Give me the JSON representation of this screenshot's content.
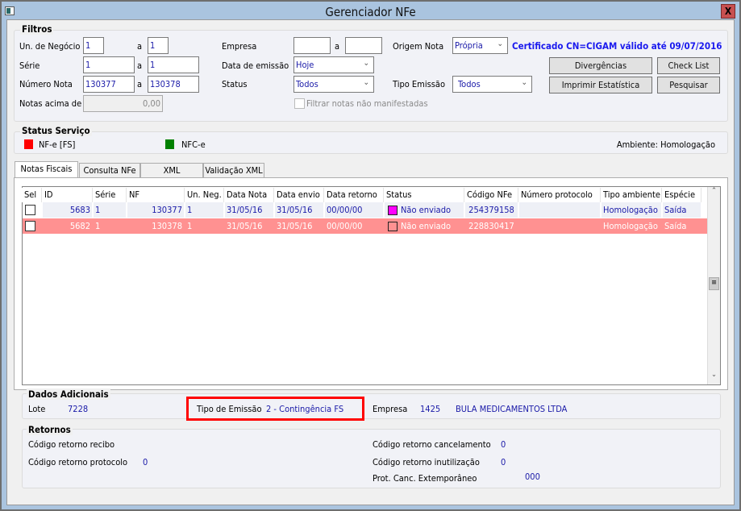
{
  "window": {
    "title": "Gerenciador NFe",
    "close_label": "X"
  },
  "filtros": {
    "title": "Filtros",
    "un_negocio": {
      "label": "Un. de Negócio",
      "from": "1",
      "to": "1"
    },
    "serie": {
      "label": "Série",
      "from": "1",
      "to": "1"
    },
    "numero_nota": {
      "label": "Número Nota",
      "from": "130377",
      "to": "130378"
    },
    "notas_acima": {
      "label": "Notas acima de",
      "value": "0,00"
    },
    "range_sep": "a",
    "empresa": {
      "label": "Empresa",
      "from": "",
      "to": ""
    },
    "data_emissao": {
      "label": "Data de emissão",
      "value": "Hoje"
    },
    "status": {
      "label": "Status",
      "value": "Todos"
    },
    "filtrar_manifestadas": {
      "label": "Filtrar notas não manifestadas",
      "checked": false
    },
    "origem_nota": {
      "label": "Origem Nota",
      "value": "Própria"
    },
    "tipo_emissao": {
      "label": "Tipo Emissão",
      "value": "Todos"
    },
    "certificado": "Certificado CN=CIGAM válido até 09/07/2016",
    "buttons": {
      "divergencias": "Divergências",
      "check_list": "Check List",
      "imprimir": "Imprimir Estatística",
      "pesquisar": "Pesquisar"
    }
  },
  "status_servico": {
    "title": "Status Serviço",
    "nfe": {
      "label": "NF-e  [FS]",
      "color": "#ff0000"
    },
    "nfce": {
      "label": "NFC-e",
      "color": "#008000"
    },
    "ambiente": "Ambiente: Homologação"
  },
  "tabs": [
    {
      "label": "Notas Fiscais",
      "active": true
    },
    {
      "label": "Consulta NFe"
    },
    {
      "label": "XML"
    },
    {
      "label": "Validação XML"
    }
  ],
  "grid": {
    "columns": [
      "Sel",
      "ID",
      "Série",
      "NF",
      "Un. Neg.",
      "Data Nota",
      "Data envio",
      "Data retorno",
      "Status",
      "Código NFe",
      "Número protocolo",
      "Tipo ambiente",
      "Espécie"
    ],
    "rows": [
      {
        "sel": false,
        "id": "5683",
        "serie": "1",
        "nf": "130377",
        "un_neg": "1",
        "data_nota": "31/05/16",
        "data_envio": "31/05/16",
        "data_retorno": "00/00/00",
        "status": "Não enviado",
        "status_color": "#ff00ff",
        "codigo_nfe": "254379158",
        "numero_protocolo": "",
        "tipo_ambiente": "Homologação",
        "especie": "Saída"
      },
      {
        "sel": false,
        "id": "5682",
        "serie": "1",
        "nf": "130378",
        "un_neg": "1",
        "data_nota": "31/05/16",
        "data_envio": "31/05/16",
        "data_retorno": "00/00/00",
        "status": "Não enviado",
        "status_color": "#ff9191",
        "codigo_nfe": "228830417",
        "numero_protocolo": "",
        "tipo_ambiente": "Homologação",
        "especie": "Saída",
        "highlighted": true,
        "row_color": "#ff9191"
      }
    ]
  },
  "dados_adicionais": {
    "title": "Dados Adicionais",
    "lote_label": "Lote",
    "lote": "7228",
    "tipo_emissao_label": "Tipo de Emissão",
    "tipo_emissao": "2 - Contingência FS",
    "empresa_label": "Empresa",
    "empresa_codigo": "1425",
    "empresa_nome": "BULA MEDICAMENTOS LTDA"
  },
  "retornos": {
    "title": "Retornos",
    "recibo_label": "Código retorno recibo",
    "recibo": "",
    "protocolo_label": "Código retorno protocolo",
    "protocolo": "0",
    "cancelamento_label": "Código retorno cancelamento",
    "cancelamento": "0",
    "inutilizacao_label": "Código retorno inutilização",
    "inutilizacao": "0",
    "extemporaneo_label": "Prot. Canc. Extemporâneo",
    "extemporaneo": "000"
  }
}
